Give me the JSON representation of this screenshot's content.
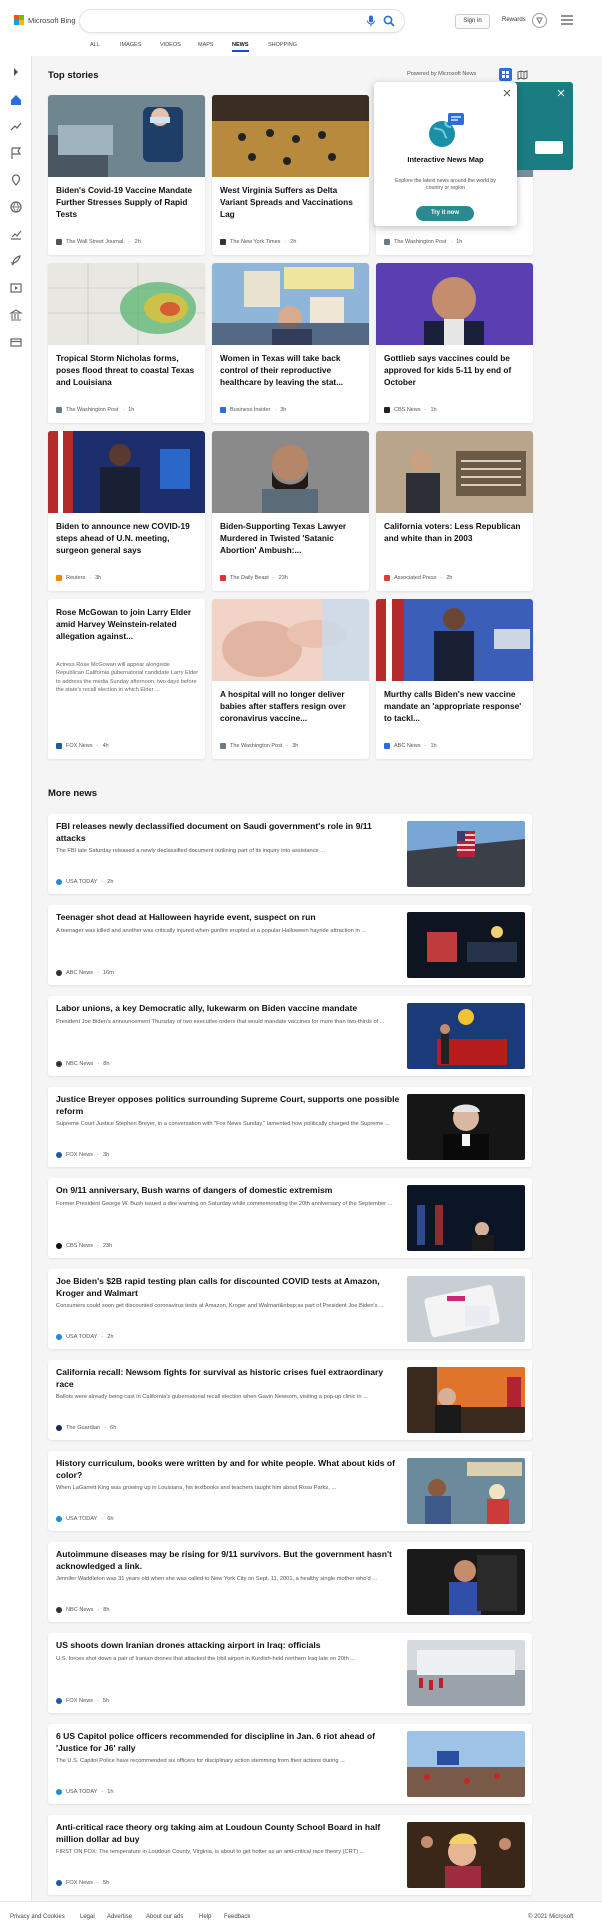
{
  "header": {
    "brand": "Microsoft Bing",
    "search_placeholder": "",
    "sign_in": "Sign in",
    "rewards": "Rewards",
    "tabs": [
      {
        "label": "ALL"
      },
      {
        "label": "IMAGES"
      },
      {
        "label": "VIDEOS"
      },
      {
        "label": "MAPS"
      },
      {
        "label": "NEWS",
        "selected": true
      },
      {
        "label": "SHOPPING"
      }
    ]
  },
  "sidebar": {
    "icons": [
      "expand-icon",
      "home-icon",
      "trending-icon",
      "flag-icon",
      "location-icon",
      "globe-icon",
      "chart-icon",
      "rocket-icon",
      "entertainment-icon",
      "bank-icon",
      "card-icon"
    ]
  },
  "top_stories": {
    "heading": "Top stories",
    "powered_by": "Powered by Microsoft News",
    "cards": [
      {
        "title": "Biden's Covid-19 Vaccine Mandate Further Stresses Supply of Rapid Tests",
        "source": "The Wall Street Journal.",
        "time": "2h"
      },
      {
        "title": "West Virginia Suffers as Delta Variant Spreads and Vaccinations Lag",
        "source": "The New York Times",
        "time": "2h"
      },
      {
        "title": "Sens",
        "title2": "squa",
        "title3": "over",
        "source": "The Washington Post",
        "time": "1h"
      },
      {
        "title": "Tropical Storm Nicholas forms, poses flood threat to coastal Texas and Louisiana",
        "source": "The Washington Post",
        "time": "1h"
      },
      {
        "title": "Women in Texas will take back control of their reproductive healthcare by leaving the stat...",
        "source": "Business Insider",
        "time": "3h"
      },
      {
        "title": "Gottlieb says vaccines could be approved for kids 5-11 by end of October",
        "source": "CBS News",
        "time": "1h"
      },
      {
        "title": "Biden to announce new COVID-19 steps ahead of U.N. meeting, surgeon general says",
        "source": "Reuters",
        "time": "3h"
      },
      {
        "title": "Biden-Supporting Texas Lawyer Murdered in Twisted 'Satanic Abortion' Ambush:...",
        "source": "The Daily Beast",
        "time": "23h"
      },
      {
        "title": "California voters: Less Republican and white than in 2003",
        "source": "Associated Press",
        "time": "2h"
      },
      {
        "title": "Rose McGowan to join Larry Elder amid Harvey Weinstein-related allegation against...",
        "desc": "Actress Rose McGowan will appear alongside Republican California gubernatorial candidate Larry Elder to address the media Sunday afternoon, two days before the state's recall election in which Elder ...",
        "source": "FOX News",
        "time": "4h"
      },
      {
        "title": "A hospital will no longer deliver babies after staffers resign over coronavirus vaccine...",
        "source": "The Washington Post",
        "time": "3h"
      },
      {
        "title": "Murthy calls Biden's new vaccine mandate an 'appropriate response' to tackl...",
        "source": "ABC News",
        "time": "1h"
      }
    ]
  },
  "popover": {
    "title": "Interactive News Map",
    "desc": "Explore the latest news around the world by country or region",
    "button": "Try it now"
  },
  "more_news": {
    "heading": "More news",
    "items": [
      {
        "title": "FBI releases newly declassified document on Saudi government's role in 9/11 attacks",
        "snippet": "The FBI late Saturday released a newly declassified document outlining part of its inquiry into assistance ...",
        "source": "USA TODAY",
        "time": "2h"
      },
      {
        "title": "Teenager shot dead at Halloween hayride event, suspect on run",
        "snippet": "A teenager was killed and another was critically injured when gunfire erupted at a popular Halloween hayride attraction in ...",
        "source": "ABC News",
        "time": "16m"
      },
      {
        "title": "Labor unions, a key Democratic ally, lukewarm on Biden vaccine mandate",
        "snippet": "President Joe Biden's announcement Thursday of two executive orders that would mandate vaccines for more than two-thirds of ...",
        "source": "NBC News",
        "time": "8h"
      },
      {
        "title": "Justice Breyer opposes politics surrounding Supreme Court, supports one possible reform",
        "snippet": "Supreme Court Justice Stephen Breyer, in a conversation with \"Fox News Sunday,\" lamented how politically charged the Supreme ...",
        "source": "FOX News",
        "time": "3h"
      },
      {
        "title": "On 9/11 anniversary, Bush warns of dangers of domestic extremism",
        "snippet": "Former President George W. Bush issued a dire warning on Saturday while commemorating the 20th anniversary of the September ...",
        "source": "CBS News",
        "time": "23h"
      },
      {
        "title": "Joe Biden's $2B rapid testing plan calls for discounted COVID tests at Amazon, Kroger and Walmart",
        "snippet": "Consumers could soon get discounted coronavirus tests at Amazon, Kroger and Walmart&nbsp;as part of President Joe Biden's ...",
        "source": "USA TODAY",
        "time": "2h"
      },
      {
        "title": "California recall: Newsom fights for survival as historic crises fuel extraordinary race",
        "snippet": "Ballots were already being cast in California's gubernatorial recall election when Gavin Newsom, visiting a pop-up clinic in ...",
        "source": "The Guardian",
        "time": "6h"
      },
      {
        "title": "History curriculum, books were written by and for white people. What about kids of color?",
        "snippet": "When LaGarrett King was growing up in Louisiana, his textbooks and teachers taught him about Rosa Parks, ...",
        "source": "USA TODAY",
        "time": "6h"
      },
      {
        "title": "Autoimmune diseases may be rising for 9/11 survivors. But the government hasn't acknowledged a link.",
        "snippet": "Jennifer Waddleton was 31 years old when she was called to New York City on Sept. 11, 2001, a healthy single mother who'd ...",
        "source": "NBC News",
        "time": "8h"
      },
      {
        "title": "US shoots down Iranian drones attacking airport in Iraq: officials",
        "snippet": "U.S. forces shot down a pair of Iranian drones that attacked the Irbil airport in Kurdish-held northern Iraq late on 20th ...",
        "source": "FOX News",
        "time": "5h"
      },
      {
        "title": "6 US Capitol police officers recommended for discipline in Jan. 6 riot ahead of 'Justice for J6' rally",
        "snippet": "The U.S. Capitol Police have recommended six officers for disciplinary action stemming from their actions during ...",
        "source": "USA TODAY",
        "time": "1h"
      },
      {
        "title": "Anti-critical race theory org taking aim at Loudoun County School Board in half million dollar ad buy",
        "snippet": "FIRST ON FOX: The temperature in Loudoun County, Virginia, is about to get hotter as an anti-critical race theory (CRT) ...",
        "source": "FOX News",
        "time": "5h"
      }
    ]
  },
  "footer": {
    "links": [
      "Privacy and Cookies",
      "Legal",
      "Advertise",
      "About our ads",
      "Help",
      "Feedback"
    ],
    "copyright": "© 2021 Microsoft"
  },
  "colors": {
    "accent": "#174ae4",
    "teal": "#1b7d82",
    "popover_button": "#2b8a8f"
  }
}
